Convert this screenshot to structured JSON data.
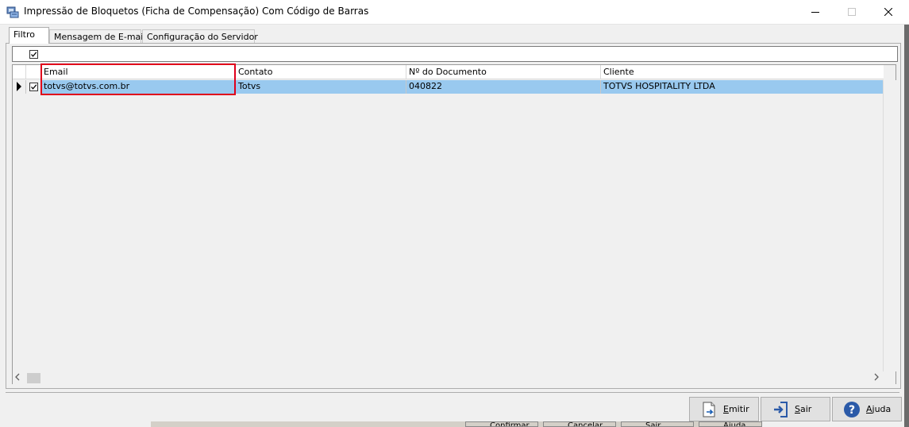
{
  "window": {
    "title": "Impressão  de Bloquetos (Ficha de Compensação) Com Código de Barras",
    "controls": {
      "minimize": "—",
      "maximize": "☐",
      "close": "✕"
    }
  },
  "tabs": [
    {
      "label": "Filtro",
      "active": true
    },
    {
      "label": "Mensagem de E-mail",
      "active": false
    },
    {
      "label": "Configuração do Servidor",
      "active": false
    }
  ],
  "filter": {
    "checked": true
  },
  "grid": {
    "columns": [
      "Email",
      "Contato",
      "Nº do Documento",
      "Cliente"
    ],
    "rows": [
      {
        "selected": true,
        "checked": true,
        "email": "totvs@totvs.com.br",
        "contato": "Totvs",
        "documento": "040822",
        "cliente": "TOTVS HOSPITALITY LTDA"
      }
    ],
    "highlight_color": "#e0001b",
    "selection_color": "#99c9ef"
  },
  "buttons": {
    "emitir": {
      "label_first": "E",
      "label_rest": "mitir"
    },
    "sair": {
      "label_first": "S",
      "label_rest": "air"
    },
    "ajuda": {
      "label_first": "A",
      "label_rest": "juda"
    }
  },
  "background_app": {
    "buttons": [
      "Confirmar",
      "Cancelar",
      "Sair",
      "Ajuda"
    ]
  }
}
